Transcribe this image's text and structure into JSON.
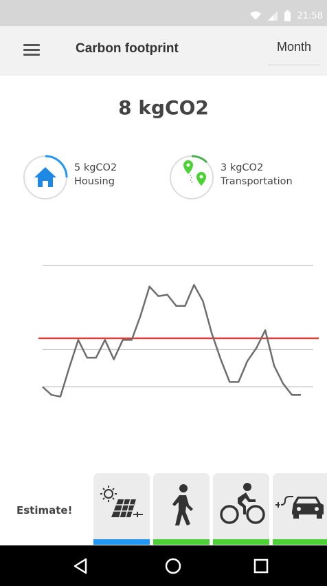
{
  "status_bar": {
    "time": "21:58",
    "icons": [
      "wifi-icon",
      "signal-icon",
      "battery-icon"
    ]
  },
  "app_bar": {
    "menu_icon": "menu-icon",
    "title": "Carbon footprint",
    "period": "Month"
  },
  "summary": {
    "total": "8 kgCO2"
  },
  "categories": [
    {
      "icon": "house-icon",
      "value": "5 kgCO2",
      "label": "Housing",
      "ring_color": "#2196f3",
      "ring_progress": 0.25
    },
    {
      "icon": "route-pins-icon",
      "value": "3 kgCO2",
      "label": "Transportation",
      "ring_color": "#4caf50",
      "ring_progress": 0.15
    }
  ],
  "chart_data": {
    "type": "line",
    "x": [
      1,
      2,
      3,
      4,
      5,
      6,
      7,
      8,
      9,
      10,
      11,
      12,
      13,
      14,
      15,
      16,
      17,
      18,
      19,
      20,
      21,
      22,
      23,
      24,
      25,
      26,
      27,
      28,
      29,
      30
    ],
    "series": [
      {
        "values": [
          2.0,
          1.5,
          1.4,
          3.2,
          4.9,
          3.8,
          3.8,
          4.9,
          3.7,
          4.9,
          4.9,
          6.4,
          8.2,
          7.6,
          7.7,
          7.0,
          7.0,
          8.3,
          7.3,
          5.3,
          3.7,
          2.3,
          2.3,
          3.6,
          4.4,
          5.5,
          3.3,
          2.2,
          1.5,
          1.5
        ],
        "color": "#6d6d6d"
      }
    ],
    "reference_line": {
      "value": 5.0,
      "color": "#e53935"
    },
    "gridlines": [
      2.0,
      4.3,
      9.5
    ],
    "ylim": [
      1.0,
      9.5
    ],
    "xlabel": "",
    "ylabel": "",
    "title": ""
  },
  "estimate": {
    "label": "Estimate!",
    "buttons": [
      {
        "icon": "solar-panel-icon",
        "color": "#2196f3"
      },
      {
        "icon": "walking-icon",
        "color": "#4cd137"
      },
      {
        "icon": "bicycle-icon",
        "color": "#4cd137"
      },
      {
        "icon": "electric-car-icon",
        "color": "#4cd137"
      }
    ]
  },
  "nav_bar": {
    "buttons": [
      "back-icon",
      "home-icon",
      "recents-icon"
    ]
  }
}
